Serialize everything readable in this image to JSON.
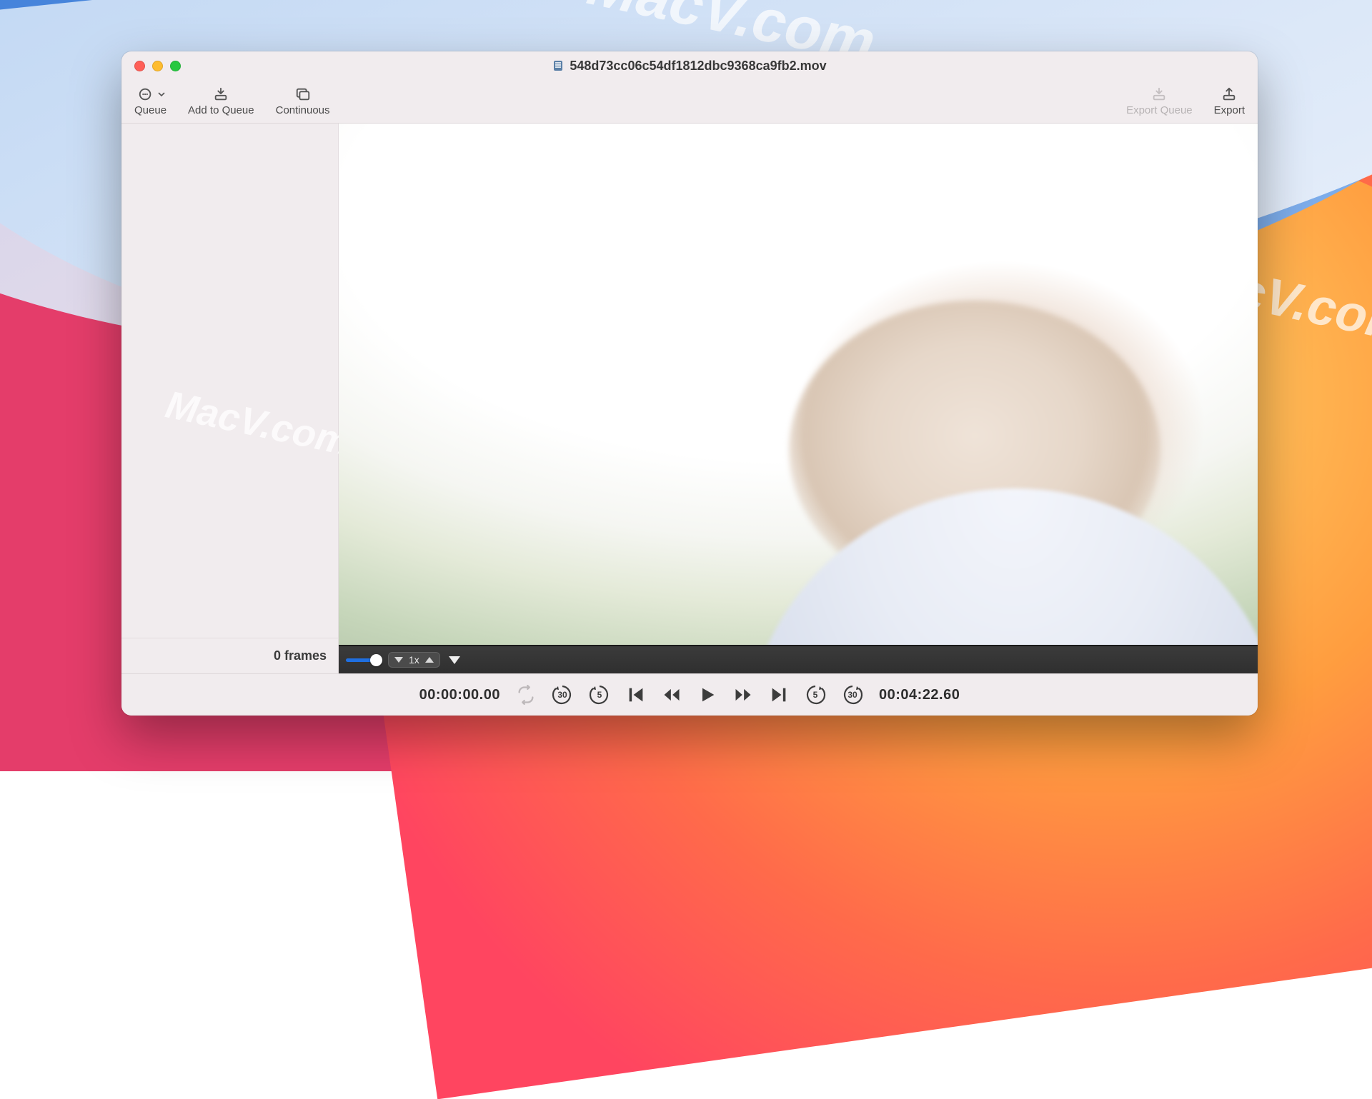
{
  "window": {
    "title": "548d73cc06c54df1812dbc9368ca9fb2.mov"
  },
  "toolbar": {
    "queue_label": "Queue",
    "add_to_queue_label": "Add to Queue",
    "continuous_label": "Continuous",
    "export_queue_label": "Export Queue",
    "export_label": "Export"
  },
  "sidebar": {
    "frames_label": "0 frames"
  },
  "playback": {
    "current_time": "00:00:00.00",
    "total_time": "00:04:22.60",
    "speed_label": "1x",
    "skip_back_large": "30",
    "skip_back_small": "5",
    "skip_fwd_small": "5",
    "skip_fwd_large": "30"
  },
  "icons": {
    "queue": "queue-icon",
    "add_to_queue": "add-to-queue-icon",
    "continuous": "continuous-icon",
    "export_queue": "export-queue-icon",
    "export": "export-icon",
    "doc": "movie-doc-icon",
    "loop": "loop-icon",
    "prev_frame": "previous-frame-icon",
    "rewind": "rewind-icon",
    "play": "play-icon",
    "forward": "fast-forward-icon",
    "next_frame": "next-frame-icon"
  },
  "watermarks": {
    "text": "MacV.com"
  }
}
